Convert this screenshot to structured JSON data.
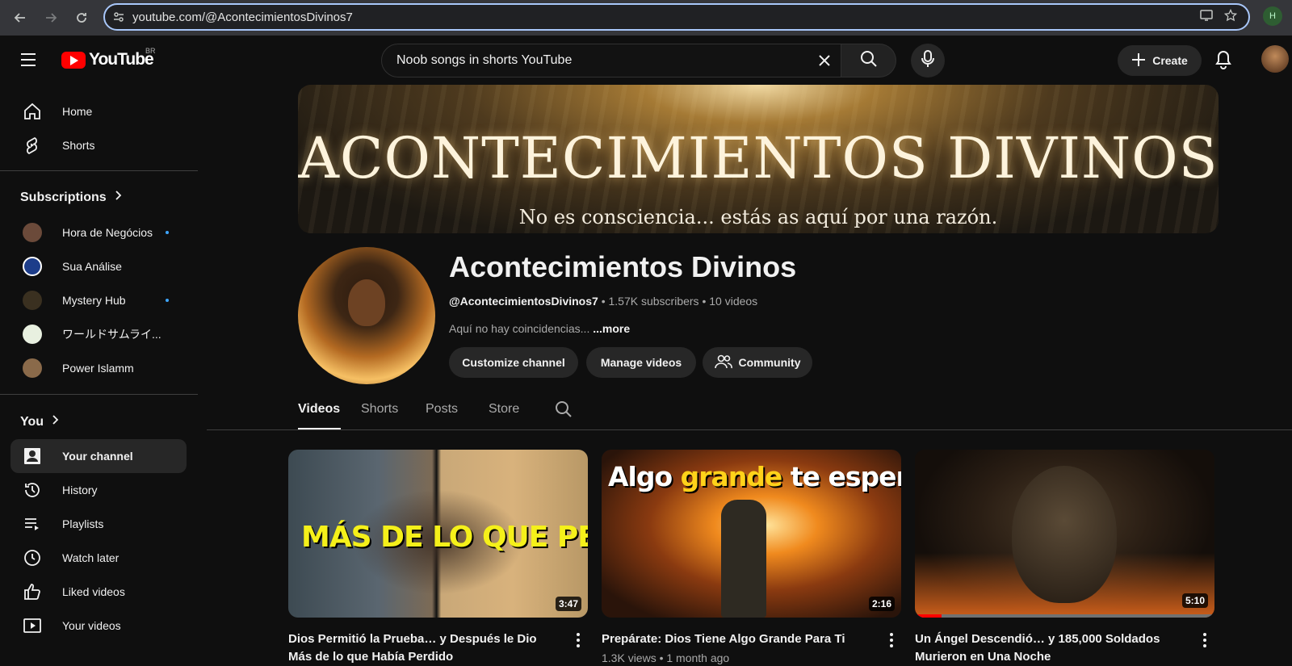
{
  "browser": {
    "url": "youtube.com/@AcontecimientosDivinos7",
    "profile_initial": "H"
  },
  "header": {
    "logo_text": "YouTube",
    "country": "BR",
    "search_query": "Noob songs in shorts YouTube",
    "create_label": "Create"
  },
  "sidebar": {
    "main": [
      {
        "label": "Home",
        "icon": "home-icon"
      },
      {
        "label": "Shorts",
        "icon": "shorts-icon"
      }
    ],
    "subscriptions_heading": "Subscriptions",
    "subscriptions": [
      {
        "label": "Hora de Negócios",
        "new": true,
        "color": "#6b4a3a"
      },
      {
        "label": "Sua Análise",
        "new": false,
        "color": "#1d3d8a"
      },
      {
        "label": "Mystery Hub",
        "new": true,
        "color": "#3a3020"
      },
      {
        "label": "ワールドサムライ...",
        "new": false,
        "color": "#e8f0e0"
      },
      {
        "label": "Power Islamm",
        "new": false,
        "color": "#8a6a4a"
      }
    ],
    "you_heading": "You",
    "you": [
      {
        "label": "Your channel",
        "icon": "your-channel-icon",
        "active": true
      },
      {
        "label": "History",
        "icon": "history-icon"
      },
      {
        "label": "Playlists",
        "icon": "playlists-icon"
      },
      {
        "label": "Watch later",
        "icon": "watch-later-icon"
      },
      {
        "label": "Liked videos",
        "icon": "liked-videos-icon"
      },
      {
        "label": "Your videos",
        "icon": "your-videos-icon"
      }
    ]
  },
  "banner": {
    "title": "ACONTECIMIENTOS DIVINOS",
    "subtitle": "No es consciencia... estás as aquí por una razón."
  },
  "channel": {
    "name": "Acontecimientos Divinos",
    "handle": "@AcontecimientosDivinos7",
    "subscribers": "1.57K subscribers",
    "videos_count": "10 videos",
    "separator": "•",
    "description": "Aquí no hay coincidencias... ",
    "more": "...more",
    "buttons": {
      "customize": "Customize channel",
      "manage": "Manage videos",
      "community": "Community"
    }
  },
  "tabs": [
    "Videos",
    "Shorts",
    "Posts",
    "Store"
  ],
  "videos": [
    {
      "title": "Dios Permitió la Prueba… y Después le Dio Más de lo que Había Perdido",
      "meta": "",
      "duration": "3:47",
      "thumb_text": "MÁS DE LO QUE PERDIÓ",
      "progress": 0
    },
    {
      "title": "Prepárate: Dios Tiene Algo Grande Para Ti",
      "meta": "1.3K views • 1 month ago",
      "duration": "2:16",
      "thumb_text_1": "Algo",
      "thumb_text_2": "grande",
      "thumb_text_3": "te espera",
      "progress": 0
    },
    {
      "title": "Un Ángel Descendió… y 185,000 Soldados Murieron en Una Noche",
      "meta": "",
      "duration": "5:10",
      "progress": 0.09
    }
  ]
}
